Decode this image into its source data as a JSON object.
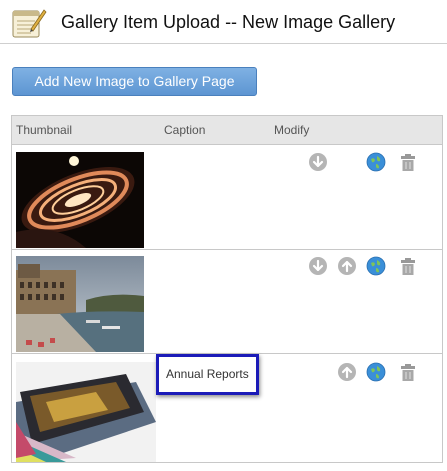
{
  "header": {
    "title": "Gallery Item Upload -- New Image Gallery",
    "icon": "notepad-icon"
  },
  "toolbar": {
    "add_label": "Add New Image to Gallery Page"
  },
  "table": {
    "columns": [
      "Thumbnail",
      "Caption",
      "Modify"
    ],
    "rows": [
      {
        "thumbnail": "ceiling-lights-photo",
        "caption": "",
        "actions": [
          "move-down-icon",
          "web-icon",
          "trash-icon"
        ]
      },
      {
        "thumbnail": "riverside-town-photo",
        "caption": "",
        "actions": [
          "move-down-icon",
          "move-up-icon",
          "web-icon",
          "trash-icon"
        ]
      },
      {
        "thumbnail": "magazine-stack-photo",
        "caption": "Annual Reports",
        "actions": [
          "move-up-icon",
          "web-icon",
          "trash-icon"
        ]
      }
    ]
  },
  "colors": {
    "button": "#6aa3dc",
    "highlight_border": "#1b1bb8",
    "header_bg": "#e6e6e6"
  }
}
